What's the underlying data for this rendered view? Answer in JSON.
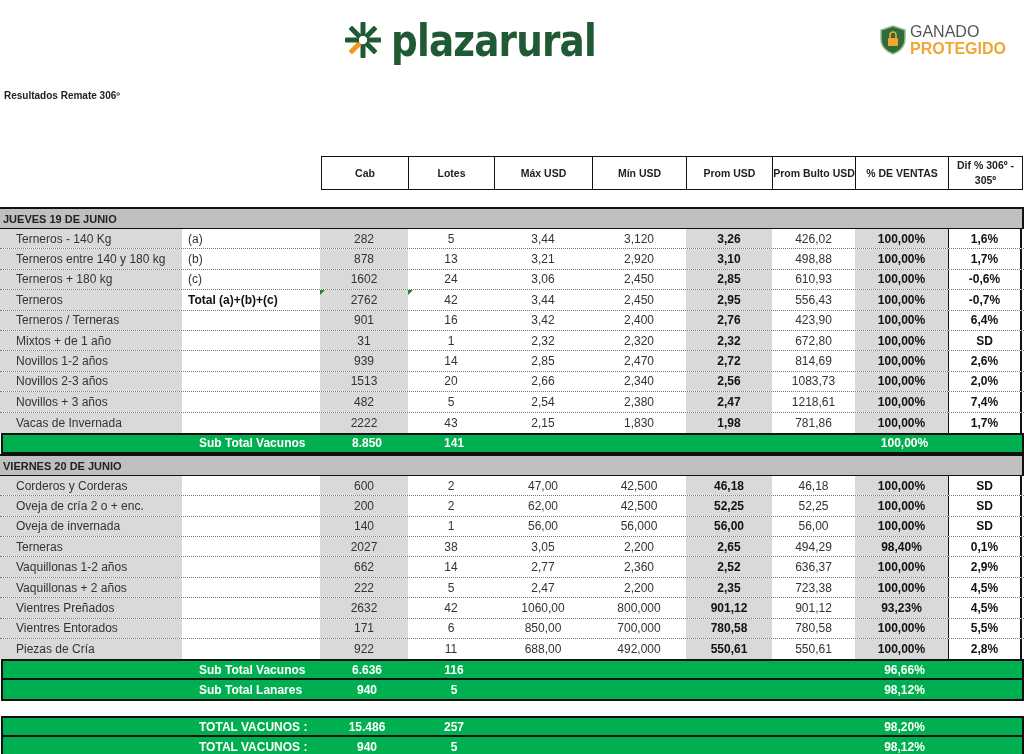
{
  "logo": {
    "text": "plazarural"
  },
  "badge": {
    "line1": "GANADO",
    "line2": "PROTEGIDO"
  },
  "title": "Resultados Remate 306º",
  "columns": [
    "Cab",
    "Lotes",
    "Máx USD",
    "Mín USD",
    "Prom USD",
    "Prom Bulto USD",
    "% DE VENTAS",
    "Dif % 306º - 305º"
  ],
  "sections": [
    {
      "title": "JUEVES 19 DE JUNIO",
      "rows": [
        {
          "kind": "item",
          "name": "Terneros - 140 Kg",
          "note": "(a)",
          "cab": "282",
          "lotes": "5",
          "max": "3,44",
          "min": "3,120",
          "prom": "3,26",
          "bulto": "426,02",
          "ventas": "100,00%",
          "dif": "1,6%"
        },
        {
          "kind": "item",
          "name": "Terneros entre 140 y 180 kg",
          "note": "(b)",
          "cab": "878",
          "lotes": "13",
          "max": "3,21",
          "min": "2,920",
          "prom": "3,10",
          "bulto": "498,88",
          "ventas": "100,00%",
          "dif": "1,7%"
        },
        {
          "kind": "item",
          "name": "Terneros + 180 kg",
          "note": "(c)",
          "cab": "1602",
          "lotes": "24",
          "max": "3,06",
          "min": "2,450",
          "prom": "2,85",
          "bulto": "610,93",
          "ventas": "100,00%",
          "dif": "-0,6%"
        },
        {
          "kind": "total",
          "name": "Terneros",
          "note": "Total (a)+(b)+(c)",
          "cab": "2762",
          "lotes": "42",
          "max": "3,44",
          "min": "2,450",
          "prom": "2,95",
          "bulto": "556,43",
          "ventas": "100,00%",
          "dif": "-0,7%"
        },
        {
          "kind": "item",
          "name": "Terneros / Terneras",
          "cab": "901",
          "lotes": "16",
          "max": "3,42",
          "min": "2,400",
          "prom": "2,76",
          "bulto": "423,90",
          "ventas": "100,00%",
          "dif": "6,4%"
        },
        {
          "kind": "item",
          "name": "Mixtos + de 1 año",
          "cab": "31",
          "lotes": "1",
          "max": "2,32",
          "min": "2,320",
          "prom": "2,32",
          "bulto": "672,80",
          "ventas": "100,00%",
          "dif": "SD"
        },
        {
          "kind": "item",
          "name": "Novillos 1-2 años",
          "cab": "939",
          "lotes": "14",
          "max": "2,85",
          "min": "2,470",
          "prom": "2,72",
          "bulto": "814,69",
          "ventas": "100,00%",
          "dif": "2,6%"
        },
        {
          "kind": "item",
          "name": "Novillos 2-3 años",
          "cab": "1513",
          "lotes": "20",
          "max": "2,66",
          "min": "2,340",
          "prom": "2,56",
          "bulto": "1083,73",
          "ventas": "100,00%",
          "dif": "2,0%"
        },
        {
          "kind": "item",
          "name": "Novillos + 3 años",
          "cab": "482",
          "lotes": "5",
          "max": "2,54",
          "min": "2,380",
          "prom": "2,47",
          "bulto": "1218,61",
          "ventas": "100,00%",
          "dif": "7,4%"
        },
        {
          "kind": "item",
          "name": "Vacas de Invernada",
          "cab": "2222",
          "lotes": "43",
          "max": "2,15",
          "min": "1,830",
          "prom": "1,98",
          "bulto": "781,86",
          "ventas": "100,00%",
          "dif": "1,7%"
        }
      ],
      "subtotals": [
        {
          "label": "Sub Total Vacunos",
          "cab": "8.850",
          "lotes": "141",
          "ventas": "100,00%"
        }
      ]
    },
    {
      "title": "VIERNES 20 DE JUNIO",
      "rows": [
        {
          "kind": "item",
          "name": "Corderos y Corderas",
          "cab": "600",
          "lotes": "2",
          "max": "47,00",
          "min": "42,500",
          "prom": "46,18",
          "bulto": "46,18",
          "ventas": "100,00%",
          "dif": "SD"
        },
        {
          "kind": "item",
          "name": "Oveja de cría 2 o + enc.",
          "cab": "200",
          "lotes": "2",
          "max": "62,00",
          "min": "42,500",
          "prom": "52,25",
          "bulto": "52,25",
          "ventas": "100,00%",
          "dif": "SD"
        },
        {
          "kind": "item",
          "name": "Oveja de invernada",
          "cab": "140",
          "lotes": "1",
          "max": "56,00",
          "min": "56,000",
          "prom": "56,00",
          "bulto": "56,00",
          "ventas": "100,00%",
          "dif": "SD"
        },
        {
          "kind": "item",
          "name": "Terneras",
          "cab": "2027",
          "lotes": "38",
          "max": "3,05",
          "min": "2,200",
          "prom": "2,65",
          "bulto": "494,29",
          "ventas": "98,40%",
          "dif": "0,1%"
        },
        {
          "kind": "item",
          "name": "Vaquillonas 1-2 años",
          "cab": "662",
          "lotes": "14",
          "max": "2,77",
          "min": "2,360",
          "prom": "2,52",
          "bulto": "636,37",
          "ventas": "100,00%",
          "dif": "2,9%"
        },
        {
          "kind": "item",
          "name": "Vaquillonas + 2 años",
          "cab": "222",
          "lotes": "5",
          "max": "2,47",
          "min": "2,200",
          "prom": "2,35",
          "bulto": "723,38",
          "ventas": "100,00%",
          "dif": "4,5%"
        },
        {
          "kind": "item",
          "name": "Vientres Preñados",
          "cab": "2632",
          "lotes": "42",
          "max": "1060,00",
          "min": "800,000",
          "prom": "901,12",
          "bulto": "901,12",
          "ventas": "93,23%",
          "dif": "4,5%"
        },
        {
          "kind": "item",
          "name": "Vientres Entorados",
          "cab": "171",
          "lotes": "6",
          "max": "850,00",
          "min": "700,000",
          "prom": "780,58",
          "bulto": "780,58",
          "ventas": "100,00%",
          "dif": "5,5%"
        },
        {
          "kind": "item",
          "name": "Piezas de Cría",
          "cab": "922",
          "lotes": "11",
          "max": "688,00",
          "min": "492,000",
          "prom": "550,61",
          "bulto": "550,61",
          "ventas": "100,00%",
          "dif": "2,8%"
        }
      ],
      "subtotals": [
        {
          "label": "Sub Total Vacunos",
          "cab": "6.636",
          "lotes": "116",
          "ventas": "96,66%"
        },
        {
          "label": "Sub Total Lanares",
          "cab": "940",
          "lotes": "5",
          "ventas": "98,12%"
        }
      ]
    }
  ],
  "totals": [
    {
      "label": "TOTAL VACUNOS :",
      "cab": "15.486",
      "lotes": "257",
      "ventas": "98,20%"
    },
    {
      "label": "TOTAL VACUNOS :",
      "cab": "940",
      "lotes": "5",
      "ventas": "98,12%"
    }
  ]
}
